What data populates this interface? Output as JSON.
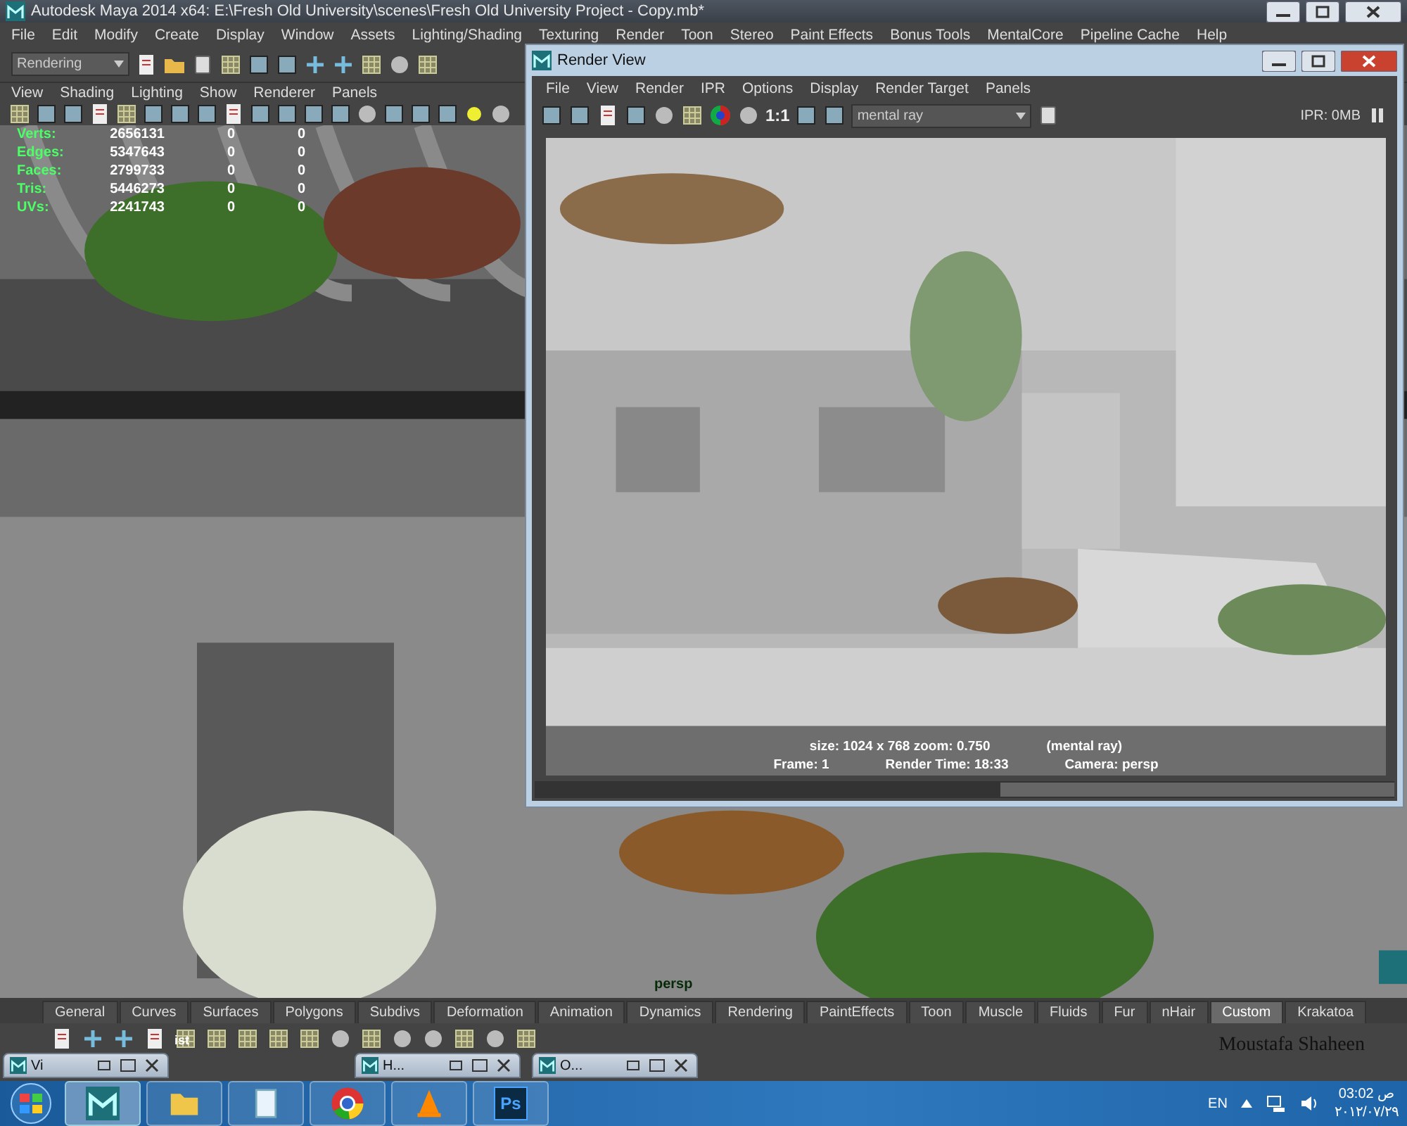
{
  "window": {
    "title": "Autodesk Maya 2014 x64: E:\\Fresh Old University\\scenes\\Fresh Old University Project - Copy.mb*"
  },
  "menu": [
    "File",
    "Edit",
    "Modify",
    "Create",
    "Display",
    "Window",
    "Assets",
    "Lighting/Shading",
    "Texturing",
    "Render",
    "Toon",
    "Stereo",
    "Paint Effects",
    "Bonus Tools",
    "MentalCore",
    "Pipeline Cache",
    "Help"
  ],
  "toolbar": {
    "mode_dropdown": "Rendering"
  },
  "viewport": {
    "menu": [
      "View",
      "Shading",
      "Lighting",
      "Show",
      "Renderer",
      "Panels"
    ],
    "stats": [
      {
        "label": "Verts:",
        "values": [
          "2656131",
          "0",
          "0"
        ]
      },
      {
        "label": "Edges:",
        "values": [
          "5347643",
          "0",
          "0"
        ]
      },
      {
        "label": "Faces:",
        "values": [
          "2799733",
          "0",
          "0"
        ]
      },
      {
        "label": "Tris:",
        "values": [
          "5446273",
          "0",
          "0"
        ]
      },
      {
        "label": "UVs:",
        "values": [
          "2241743",
          "0",
          "0"
        ]
      }
    ],
    "camera_label": "persp"
  },
  "render_view": {
    "title": "Render View",
    "menu": [
      "File",
      "View",
      "Render",
      "IPR",
      "Options",
      "Display",
      "Render Target",
      "Panels"
    ],
    "ratio": "1:1",
    "renderer": "mental ray",
    "ipr": "IPR: 0MB",
    "info": [
      "size: 1024 x 768 zoom: 0.750",
      "(mental ray)"
    ],
    "status": [
      "Frame: 1",
      "Render Time: 18:33",
      "Camera: persp"
    ]
  },
  "shelf": {
    "tabs": [
      {
        "label": "General",
        "selected": false
      },
      {
        "label": "Curves",
        "selected": false
      },
      {
        "label": "Surfaces",
        "selected": false
      },
      {
        "label": "Polygons",
        "selected": false
      },
      {
        "label": "Subdivs",
        "selected": false
      },
      {
        "label": "Deformation",
        "selected": false
      },
      {
        "label": "Animation",
        "selected": false
      },
      {
        "label": "Dynamics",
        "selected": false
      },
      {
        "label": "Rendering",
        "selected": false
      },
      {
        "label": "PaintEffects",
        "selected": false
      },
      {
        "label": "Toon",
        "selected": false
      },
      {
        "label": "Muscle",
        "selected": false
      },
      {
        "label": "Fluids",
        "selected": false
      },
      {
        "label": "Fur",
        "selected": false
      },
      {
        "label": "nHair",
        "selected": false
      },
      {
        "label": "Custom",
        "selected": true
      },
      {
        "label": "Krakatoa",
        "selected": false
      }
    ],
    "label": "ist"
  },
  "signature": "Moustafa Shaheen",
  "minimized_windows": [
    {
      "title": "Vi"
    },
    {
      "title": "H..."
    },
    {
      "title": "O..."
    }
  ],
  "taskbar": {
    "apps": [
      {
        "kind": "maya",
        "selected": true
      },
      {
        "kind": "folder",
        "selected": false
      },
      {
        "kind": "notepad",
        "selected": false
      },
      {
        "kind": "chrome",
        "selected": false
      },
      {
        "kind": "vlc",
        "selected": false
      },
      {
        "kind": "photoshop",
        "selected": false,
        "label": "Ps"
      }
    ],
    "language": "EN",
    "time": "03:02 ص",
    "date": "٢٠١٢/٠٧/٢٩"
  }
}
